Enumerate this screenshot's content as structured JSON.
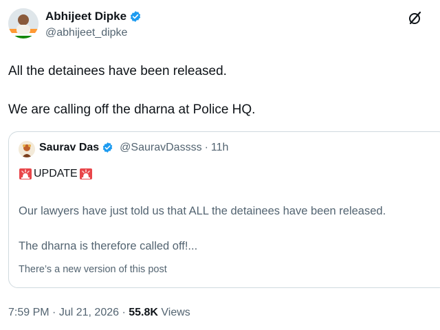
{
  "author": {
    "display_name": "Abhijeet Dipke",
    "handle": "@abhijeet_dipke",
    "verified_icon": "verified-badge-icon",
    "badge_color": "#1d9bf0"
  },
  "toolbar": {
    "grok_icon": "grok-icon"
  },
  "tweet": {
    "paragraphs": [
      "All the detainees have been released.",
      "We are calling off the dharna at Police HQ."
    ]
  },
  "quote": {
    "display_name": "Saurav Das",
    "handle": "@SauravDassss",
    "separator": "·",
    "time": "11h",
    "update_label": "UPDATE",
    "siren_icon": "rotating-light-emoji",
    "text_1": "Our lawyers have just told us that ALL the detainees have been released.",
    "text_2": "The dharna is therefore called off!...",
    "version_note": "There’s a new version of this post"
  },
  "meta": {
    "time": "7:59 PM",
    "separator": "·",
    "date": "Jul 21, 2026",
    "views_count": "55.8K",
    "views_label": "Views"
  },
  "colors": {
    "text_primary": "#0f1419",
    "text_secondary": "#536471",
    "border": "#cfd9de",
    "accent": "#1d9bf0"
  }
}
